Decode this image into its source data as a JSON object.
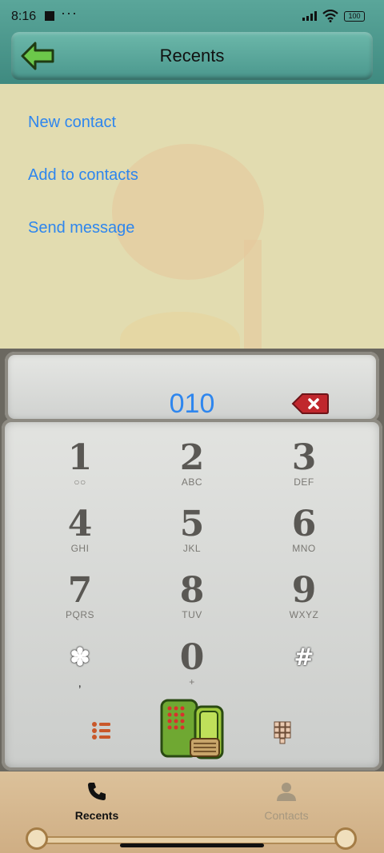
{
  "status": {
    "time": "8:16",
    "dots": "···",
    "battery": "100"
  },
  "header": {
    "title": "Recents"
  },
  "menu": [
    "New contact",
    "Add to contacts",
    "Send message"
  ],
  "display": {
    "number": "010"
  },
  "keys": [
    {
      "digit": "1",
      "letters": "○○"
    },
    {
      "digit": "2",
      "letters": "ABC"
    },
    {
      "digit": "3",
      "letters": "DEF"
    },
    {
      "digit": "4",
      "letters": "GHI"
    },
    {
      "digit": "5",
      "letters": "JKL"
    },
    {
      "digit": "6",
      "letters": "MNO"
    },
    {
      "digit": "7",
      "letters": "PQRS"
    },
    {
      "digit": "8",
      "letters": "TUV"
    },
    {
      "digit": "9",
      "letters": "WXYZ"
    },
    {
      "digit": "✽",
      "letters": ","
    },
    {
      "digit": "0",
      "letters": "+"
    },
    {
      "digit": "#",
      "letters": ""
    }
  ],
  "nav": {
    "recents": "Recents",
    "contacts": "Contacts"
  },
  "colors": {
    "accent": "#2e86ee",
    "header": "#4a978d",
    "backspace": "#c0272d",
    "callButton": "#6fa832"
  }
}
